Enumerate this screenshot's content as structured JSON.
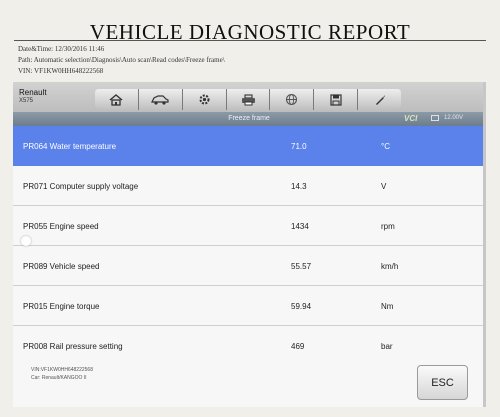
{
  "report": {
    "title": "VEHICLE DIAGNOSTIC REPORT",
    "date_time": "Date&Time: 12/30/2016 11:46",
    "path": "Path: Automatic selection\\Diagnosis\\Auto scan\\Read codes\\Freeze frame\\",
    "vin": "VIN: VF1KW0HH648222568"
  },
  "app": {
    "brand": "Renault",
    "model": "X575",
    "toolbar": {
      "icons": [
        "home-icon",
        "car-icon",
        "gear-icon",
        "printer-icon",
        "globe-icon",
        "save-icon",
        "pen-icon"
      ]
    },
    "subtitle": "Freeze frame",
    "vci_label": "VCI",
    "battery_voltage": "12.00V",
    "colors": {
      "selected_row": "#5b82ea",
      "header_bar": "#7a8a99",
      "toolbar_bg": "#c8c8c8"
    }
  },
  "rows": [
    {
      "name": "PR064  Water temperature",
      "value": "71.0",
      "unit": "°C",
      "selected": true
    },
    {
      "name": "PR071  Computer supply voltage",
      "value": "14.3",
      "unit": "V",
      "selected": false
    },
    {
      "name": "PR055  Engine speed",
      "value": "1434",
      "unit": "rpm",
      "selected": false
    },
    {
      "name": "PR089  Vehicle speed",
      "value": "55.57",
      "unit": "km/h",
      "selected": false
    },
    {
      "name": "PR015  Engine torque",
      "value": "59.94",
      "unit": "Nm",
      "selected": false
    },
    {
      "name": "PR008  Rail pressure setting",
      "value": "469",
      "unit": "bar",
      "selected": false
    }
  ],
  "footer": {
    "vin": "VIN:VF1KW0HH648222568",
    "car": "Car: Renault/KANGOO II",
    "esc_label": "ESC"
  }
}
